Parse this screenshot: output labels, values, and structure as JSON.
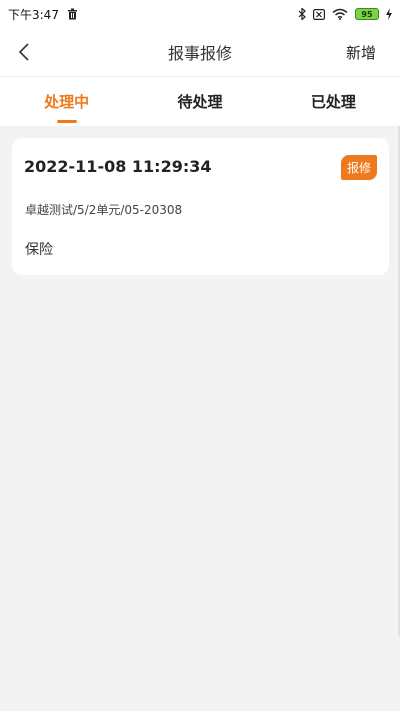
{
  "status_bar": {
    "time": "下午3:47",
    "battery": "95",
    "icons": [
      "trash-icon",
      "bluetooth-icon",
      "sim-x-icon",
      "wifi-icon",
      "battery-icon",
      "charging-icon"
    ]
  },
  "nav": {
    "title": "报事报修",
    "action_label": "新增",
    "back_icon": "chevron-left-icon"
  },
  "tabs": [
    {
      "label": "处理中",
      "active": true
    },
    {
      "label": "待处理",
      "active": false
    },
    {
      "label": "已处理",
      "active": false
    }
  ],
  "records": [
    {
      "time": "2022-11-08 11:29:34",
      "tag": "报修",
      "address": "卓越测试/5/2单元/05-20308",
      "type": "保险"
    }
  ],
  "colors": {
    "accent": "#ef7a1d",
    "background": "#f3f3f3",
    "card": "#ffffff"
  }
}
